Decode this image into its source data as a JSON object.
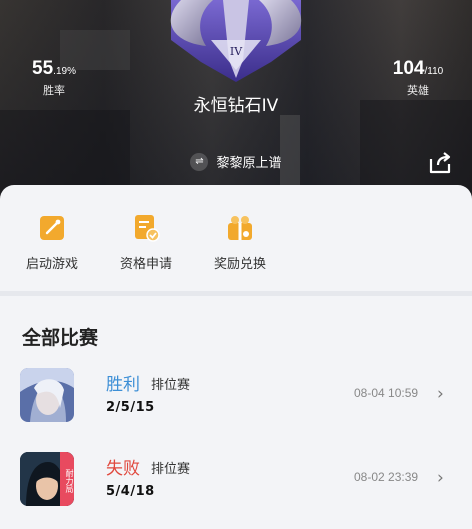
{
  "hero": {
    "win_rate": {
      "value": "55",
      "unit": ".19%",
      "label": "胜率"
    },
    "heroes": {
      "value": "104",
      "unit": "/110",
      "label": "英雄"
    },
    "rank_badge_numeral": "IV",
    "rank_name": "永恒钻石IV",
    "season_label": "黎黎原上谱",
    "season_icon_glyph": "⇌"
  },
  "actions": [
    {
      "label": "启动游戏",
      "icon": "launch-game-icon"
    },
    {
      "label": "资格申请",
      "icon": "apply-icon"
    },
    {
      "label": "奖励兑换",
      "icon": "gift-icon"
    }
  ],
  "section": {
    "title": "全部比赛"
  },
  "matches": [
    {
      "result": "胜利",
      "mode": "排位赛",
      "kda": "2/5/15",
      "time": "08-04 10:59"
    },
    {
      "result": "失败",
      "mode": "排位赛",
      "kda": "5/4/18",
      "time": "08-02 23:39",
      "avatar_tag": "耐力局"
    }
  ],
  "colors": {
    "accent_orange": "#f2a92d",
    "win": "#3d8fd6",
    "lose": "#e0473c",
    "badge_purple": "#5b46b8"
  },
  "chevron_glyph": "›"
}
